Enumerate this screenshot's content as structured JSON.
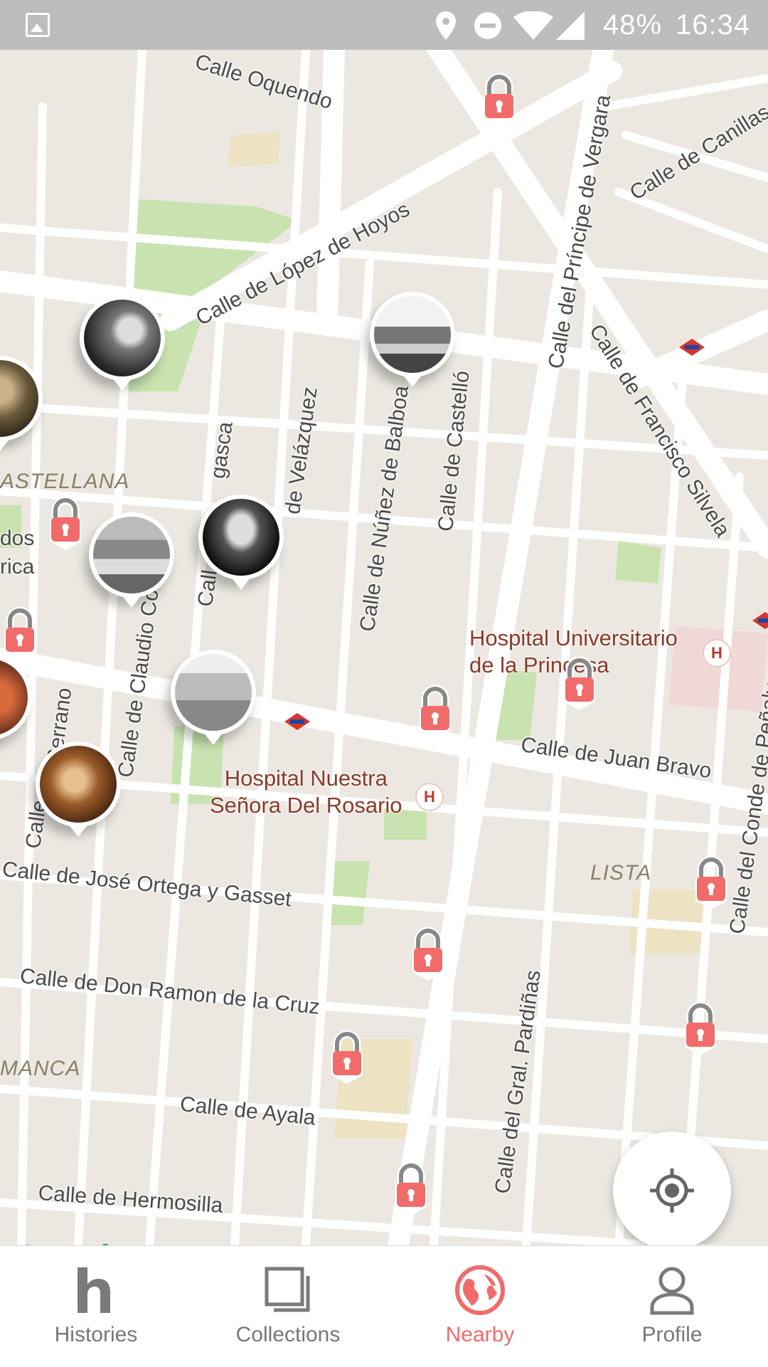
{
  "status_bar": {
    "battery": "48%",
    "time": "16:34",
    "icons": [
      "image-icon",
      "location-icon",
      "do-not-disturb-icon",
      "wifi-icon",
      "signal-icon"
    ]
  },
  "map": {
    "streets": [
      "Calle Oquendo",
      "Calle de López de Hoyos",
      "Calle del Príncipe de Vergara",
      "Calle de Canillas",
      "Calle de Francisco Silvela",
      "Calle de Núñez de Balboa",
      "Calle de Castelló",
      "de Velázquez",
      "Call",
      "gasca",
      "Calle de Claudio Coe",
      "Serrano",
      "Calle",
      "Calle de Juan Bravo",
      "Calle del Conde de Peñalver",
      "Calle de José Ortega y Gasset",
      "Calle de Don Ramon de la Cruz",
      "Calle del Gral. Pardiñas",
      "Calle de Ayala",
      "Calle de Hermosilla",
      "dos",
      "rica"
    ],
    "districts": [
      "ASTELLANA",
      "LISTA",
      "MANCA"
    ],
    "pois": {
      "hospital_princesa": "Hospital Universitario\nde la Princesa",
      "hospital_rosario": "Hospital Nuestra\nSeñora Del Rosario",
      "hospital_icon": "H"
    },
    "google_logo": "Google"
  },
  "locate_button": {
    "icon": "my-location-icon"
  },
  "bottom_nav": {
    "tabs": [
      {
        "label": "Histories",
        "icon": "histories-icon",
        "active": false
      },
      {
        "label": "Collections",
        "icon": "collections-icon",
        "active": false
      },
      {
        "label": "Nearby",
        "icon": "globe-icon",
        "active": true
      },
      {
        "label": "Profile",
        "icon": "person-icon",
        "active": false
      }
    ]
  },
  "colors": {
    "accent": "#f26b6b",
    "map_background": "#ece8e1",
    "park": "#c8e3b0",
    "road": "#ffffff",
    "status_bar": "#bdbdbd"
  }
}
